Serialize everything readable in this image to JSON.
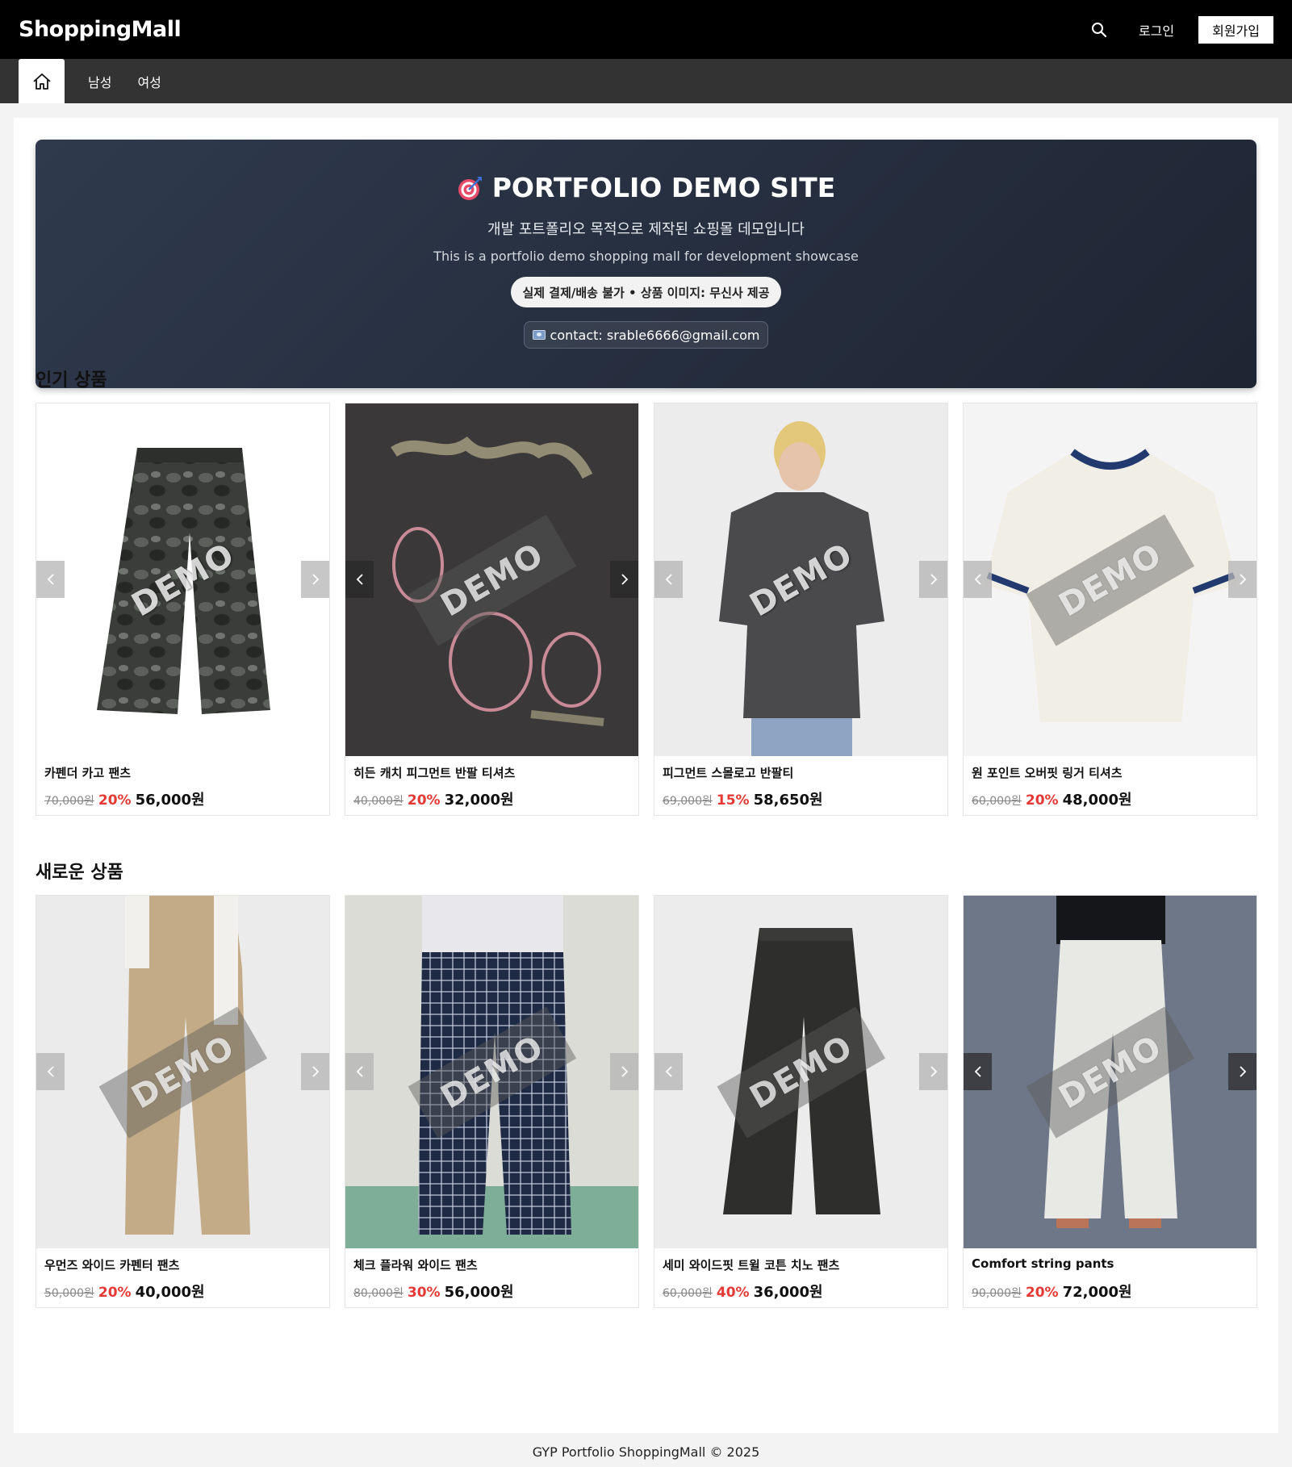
{
  "header": {
    "logo": "ShoppingMall",
    "login": "로그인",
    "signup": "회원가입",
    "search_icon": "search-icon"
  },
  "nav": {
    "home_icon": "home-icon",
    "items": [
      "남성",
      "여성"
    ]
  },
  "hero": {
    "title": "PORTFOLIO DEMO SITE",
    "subtitle_ko": "개발 포트폴리오 목적으로 제작된 쇼핑몰 데모입니다",
    "subtitle_en": "This is a portfolio demo shopping mall for development showcase",
    "badge": "실제 결제/배송 불가 • 상품 이미지: 무신사 제공",
    "contact": "contact: srable6666@gmail.com"
  },
  "popular": {
    "title": "인기 상품",
    "products": [
      {
        "name": "카펜더 카고 팬츠",
        "original": "70,000원",
        "discount": "20%",
        "final": "56,000원",
        "demo": "DEMO",
        "bg": "#ffffff"
      },
      {
        "name": "히든 캐치 피그먼트 반팔 티셔츠",
        "original": "40,000원",
        "discount": "20%",
        "final": "32,000원",
        "demo": "DEMO",
        "bg": "#3a3838"
      },
      {
        "name": "피그먼트 스몰로고 반팔티",
        "original": "69,000원",
        "discount": "15%",
        "final": "58,650원",
        "demo": "DEMO",
        "bg": "#ececec"
      },
      {
        "name": "원 포인트 오버핏 링거 티셔츠",
        "original": "60,000원",
        "discount": "20%",
        "final": "48,000원",
        "demo": "DEMO",
        "bg": "#f4f4f5"
      }
    ]
  },
  "new": {
    "title": "새로운 상품",
    "products": [
      {
        "name": "우먼즈 와이드 카펜터 팬츠",
        "original": "50,000원",
        "discount": "20%",
        "final": "40,000원",
        "demo": "DEMO",
        "bg": "#ebebeb"
      },
      {
        "name": "체크 플라워 와이드 팬츠",
        "original": "80,000원",
        "discount": "30%",
        "final": "56,000원",
        "demo": "DEMO",
        "bg": "#dcdcd6"
      },
      {
        "name": "세미 와이드핏 트윌 코튼 치노 팬츠",
        "original": "60,000원",
        "discount": "40%",
        "final": "36,000원",
        "demo": "DEMO",
        "bg": "#ececec"
      },
      {
        "name": "Comfort string pants",
        "original": "90,000원",
        "discount": "20%",
        "final": "72,000원",
        "demo": "DEMO",
        "bg": "#6e7788"
      }
    ]
  },
  "footer": "GYP Portfolio ShoppingMall © 2025"
}
